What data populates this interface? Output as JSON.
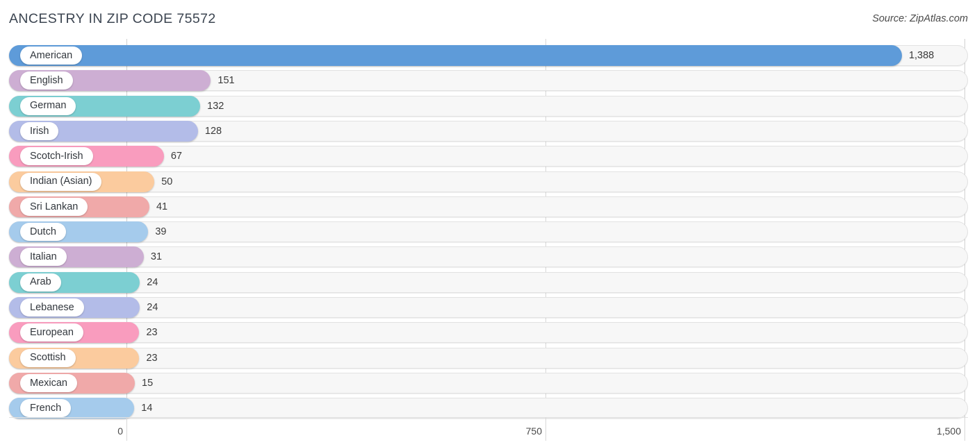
{
  "header": {
    "title": "ANCESTRY IN ZIP CODE 75572",
    "source": "Source: ZipAtlas.com"
  },
  "chart_data": {
    "type": "bar",
    "orientation": "horizontal",
    "title": "ANCESTRY IN ZIP CODE 75572",
    "xlabel": "",
    "ylabel": "",
    "xlim": [
      0,
      1500
    ],
    "grid": true,
    "legend": false,
    "xticks": [
      "0",
      "750",
      "1,500"
    ],
    "xtick_values": [
      0,
      750,
      1500
    ],
    "categories": [
      "American",
      "English",
      "German",
      "Irish",
      "Scotch-Irish",
      "Indian (Asian)",
      "Sri Lankan",
      "Dutch",
      "Italian",
      "Arab",
      "Lebanese",
      "European",
      "Scottish",
      "Mexican",
      "French"
    ],
    "values": [
      1388,
      151,
      132,
      128,
      67,
      50,
      41,
      39,
      31,
      24,
      24,
      23,
      23,
      15,
      14
    ],
    "value_labels": [
      "1,388",
      "151",
      "132",
      "128",
      "67",
      "50",
      "41",
      "39",
      "31",
      "24",
      "24",
      "23",
      "23",
      "15",
      "14"
    ],
    "bar_colors": [
      "#5e9bd9",
      "#cdaed3",
      "#7ccfd2",
      "#b3bce8",
      "#f99cbe",
      "#fbcb9e",
      "#f0a9a9",
      "#a5cbec",
      "#cdaed3",
      "#7ccfd2",
      "#b3bce8",
      "#f99cbe",
      "#fbcb9e",
      "#f0a9a9",
      "#a5cbec"
    ]
  }
}
